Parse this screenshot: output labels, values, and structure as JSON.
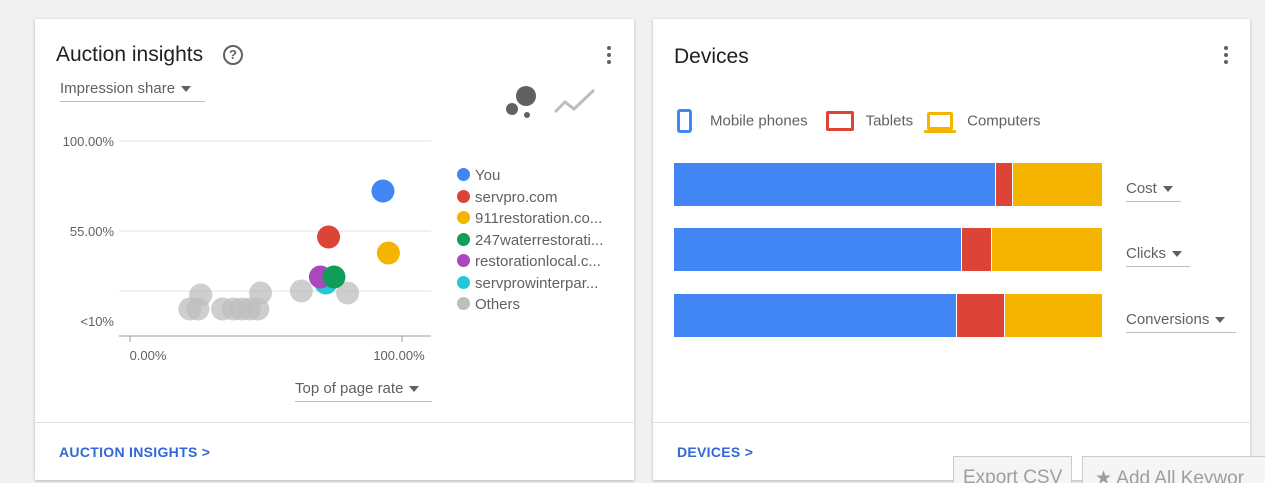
{
  "auction": {
    "title": "Auction insights",
    "help_icon": "help-icon",
    "menu_icon": "more-vert-icon",
    "metric_dropdown": "Impression share",
    "chart_type_icons": [
      "bubble-chart-icon",
      "trend-line-icon"
    ],
    "x_axis_dropdown": "Top of page rate",
    "footer_link": "AUCTION INSIGHTS >"
  },
  "devices": {
    "title": "Devices",
    "menu_icon": "more-vert-icon",
    "legend": [
      {
        "label": "Mobile phones",
        "icon": "phone-icon",
        "color": "#4285f4"
      },
      {
        "label": "Tablets",
        "icon": "tablet-icon",
        "color": "#db4437"
      },
      {
        "label": "Computers",
        "icon": "computer-icon",
        "color": "#f4b400"
      }
    ],
    "metrics": [
      "Cost",
      "Clicks",
      "Conversions"
    ],
    "footer_link": "DEVICES >"
  },
  "buttons": {
    "export_csv": "Export CSV",
    "add_all_keywords": "Add All Keywor"
  },
  "chart_data": [
    {
      "type": "scatter",
      "title": "",
      "xlabel": "Top of page rate",
      "ylabel": "Impression share",
      "x_ticks": [
        "0.00%",
        "100.00%"
      ],
      "y_ticks": [
        "<10%",
        "55.00%",
        "100.00%"
      ],
      "xlim": [
        0,
        100
      ],
      "ylim": [
        10,
        100
      ],
      "grid": true,
      "legend_position": "right",
      "series": [
        {
          "name": "You",
          "color": "#4285f4",
          "points": [
            [
              93,
              75
            ]
          ]
        },
        {
          "name": "servpro.com",
          "color": "#db4437",
          "points": [
            [
              73,
              52
            ]
          ]
        },
        {
          "name": "911restoration.co...",
          "color": "#f4b400",
          "points": [
            [
              95,
              44
            ]
          ]
        },
        {
          "name": "247waterrestorati...",
          "color": "#0f9d58",
          "points": [
            [
              75,
              32
            ]
          ]
        },
        {
          "name": "restorationlocal.c...",
          "color": "#ab47bc",
          "points": [
            [
              70,
              32
            ]
          ]
        },
        {
          "name": "servprowinterpar...",
          "color": "#26c6da",
          "points": [
            [
              72,
              29
            ]
          ]
        },
        {
          "name": "Others",
          "color": "#bdbdbd",
          "points": [
            [
              22,
              16
            ],
            [
              25,
              16
            ],
            [
              26,
              23
            ],
            [
              34,
              16
            ],
            [
              38,
              16
            ],
            [
              41,
              16
            ],
            [
              44,
              16
            ],
            [
              47,
              16
            ],
            [
              48,
              24
            ],
            [
              63,
              25
            ],
            [
              80,
              24
            ]
          ]
        }
      ]
    },
    {
      "type": "bar",
      "orientation": "horizontal-stacked-percent",
      "categories": [
        "Cost",
        "Clicks",
        "Conversions"
      ],
      "series": [
        {
          "name": "Mobile phones",
          "color": "#4285f4",
          "values": [
            75,
            67,
            66
          ]
        },
        {
          "name": "Tablets",
          "color": "#db4437",
          "values": [
            4,
            7,
            11
          ]
        },
        {
          "name": "Computers",
          "color": "#f4b400",
          "values": [
            21,
            26,
            23
          ]
        }
      ]
    }
  ]
}
